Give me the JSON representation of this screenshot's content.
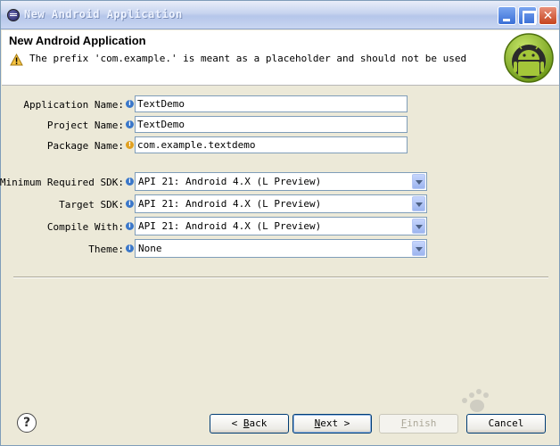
{
  "window": {
    "title": "New Android Application",
    "icon": "eclipse-icon",
    "controls": [
      "minimize-icon",
      "maximize-icon",
      "close-icon"
    ]
  },
  "header": {
    "title": "New Android Application",
    "message": "The prefix 'com.example.' is meant as a placeholder and should not be used",
    "message_icon": "warning-icon",
    "logo": "android-logo"
  },
  "fields": {
    "application_name": {
      "label": "Application Name:",
      "value": "TextDemo",
      "icon": "info-icon"
    },
    "project_name": {
      "label": "Project Name:",
      "value": "TextDemo",
      "icon": "info-icon"
    },
    "package_name": {
      "label": "Package Name:",
      "value": "com.example.textdemo",
      "icon": "warning-icon"
    }
  },
  "selects": {
    "min_sdk": {
      "label": "Minimum Required SDK:",
      "value": "API 21: Android 4.X (L Preview)"
    },
    "target_sdk": {
      "label": "Target SDK:",
      "value": "API 21: Android 4.X (L Preview)"
    },
    "compile_with": {
      "label": "Compile With:",
      "value": "API 21: Android 4.X (L Preview)"
    },
    "theme": {
      "label": "Theme:",
      "value": "None"
    }
  },
  "buttons": {
    "help": "?",
    "back_prefix": "< ",
    "back_mn": "B",
    "back_rest": "ack",
    "next_mn": "N",
    "next_rest": "ext >",
    "finish_mn": "F",
    "finish_rest": "inish",
    "cancel": "Cancel"
  },
  "colors": {
    "titlebar": "#c6d3ef",
    "dialog_background": "#ece9d8",
    "android_green": "#a4c639"
  }
}
